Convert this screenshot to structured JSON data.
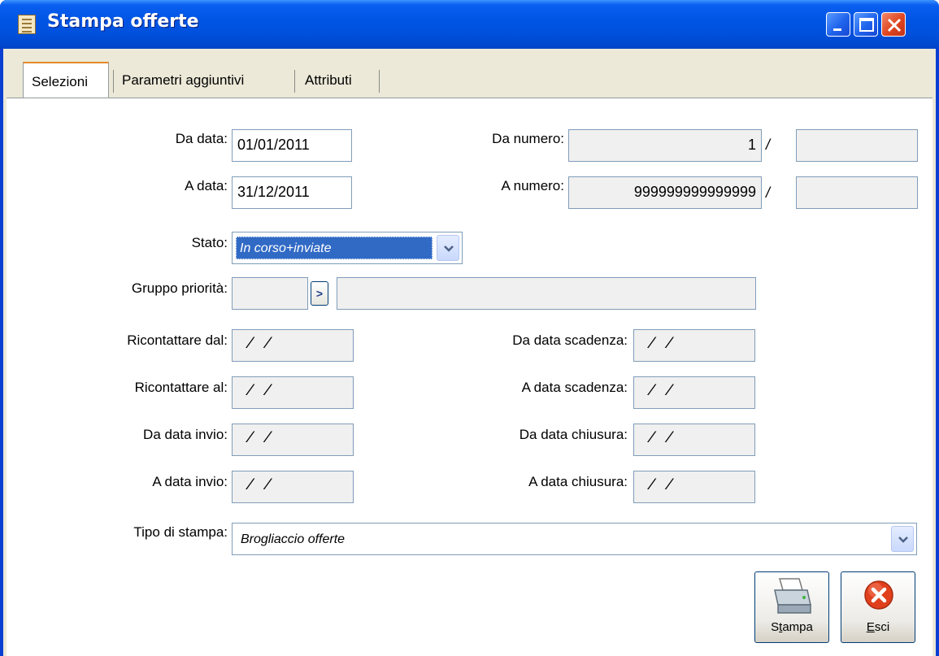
{
  "window": {
    "title": "Stampa offerte",
    "buttons": {
      "minimize": "minimize-icon",
      "maximize": "maximize-icon",
      "close": "close-icon"
    }
  },
  "tabs": [
    {
      "label": "Selezioni",
      "active": true
    },
    {
      "label": "Parametri aggiuntivi",
      "active": false
    },
    {
      "label": "Attributi",
      "active": false
    }
  ],
  "form": {
    "da_data": {
      "label": "Da data:",
      "value": "01/01/2011"
    },
    "a_data": {
      "label": "A data:",
      "value": "31/12/2011"
    },
    "da_numero": {
      "label": "Da numero:",
      "value": "1",
      "separator": "/",
      "serie": ""
    },
    "a_numero": {
      "label": "A numero:",
      "value": "999999999999999",
      "separator": "/",
      "serie": ""
    },
    "stato": {
      "label": "Stato:",
      "value": "In corso+inviate"
    },
    "gruppo_priorita": {
      "label": "Gruppo priorità:",
      "code": "",
      "description": "",
      "zoom": ">"
    },
    "ricontattare_dal": {
      "label": "Ricontattare dal:",
      "value": " /  /"
    },
    "ricontattare_al": {
      "label": "Ricontattare al:",
      "value": " /  /"
    },
    "da_data_invio": {
      "label": "Da data invio:",
      "value": " /  /"
    },
    "a_data_invio": {
      "label": "A data invio:",
      "value": " /  /"
    },
    "da_data_scadenza": {
      "label": "Da data scadenza:",
      "value": " /  /"
    },
    "a_data_scadenza": {
      "label": "A data scadenza:",
      "value": " /  /"
    },
    "da_data_chiusura": {
      "label": "Da data chiusura:",
      "value": " /  /"
    },
    "a_data_chiusura": {
      "label": "A data chiusura:",
      "value": " /  /"
    },
    "tipo_di_stampa": {
      "label": "Tipo di stampa:",
      "value": "Brogliaccio offerte"
    }
  },
  "actions": {
    "stampa": {
      "label_pre": "S",
      "label_ul": "t",
      "label_post": "ampa",
      "icon": "printer-icon"
    },
    "esci": {
      "label_pre": "",
      "label_ul": "E",
      "label_post": "sci",
      "icon": "exit-icon"
    }
  },
  "colors": {
    "accent_title": "#0055e5",
    "selection": "#316ac5",
    "tab_highlight": "#e68b2c"
  }
}
